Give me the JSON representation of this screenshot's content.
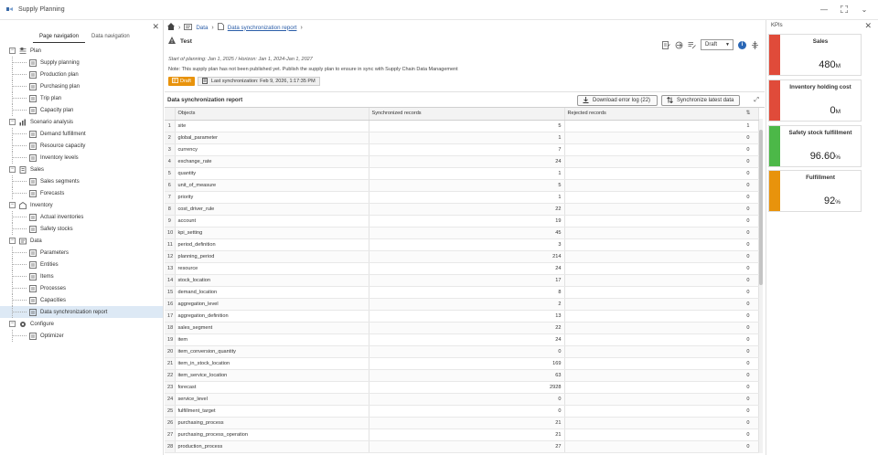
{
  "window": {
    "title": "Supply Planning"
  },
  "left_panel": {
    "tabs": [
      "Page navigation",
      "Data navigation"
    ],
    "tree": [
      {
        "label": "Plan",
        "icon": "plan-icon",
        "children": [
          {
            "label": "Supply planning",
            "icon": "supply-planning-icon"
          },
          {
            "label": "Production plan",
            "icon": "production-plan-icon"
          },
          {
            "label": "Purchasing plan",
            "icon": "purchasing-plan-icon"
          },
          {
            "label": "Trip plan",
            "icon": "trip-plan-icon"
          },
          {
            "label": "Capacity plan",
            "icon": "capacity-plan-icon"
          }
        ]
      },
      {
        "label": "Scenario analysis",
        "icon": "scenario-analysis-icon",
        "children": [
          {
            "label": "Demand fulfillment",
            "icon": "demand-fulfillment-icon"
          },
          {
            "label": "Resource capacity",
            "icon": "resource-capacity-icon"
          },
          {
            "label": "Inventory levels",
            "icon": "inventory-levels-icon"
          }
        ]
      },
      {
        "label": "Sales",
        "icon": "sales-icon",
        "children": [
          {
            "label": "Sales segments",
            "icon": "sales-segments-icon"
          },
          {
            "label": "Forecasts",
            "icon": "forecasts-icon"
          }
        ]
      },
      {
        "label": "Inventory",
        "icon": "inventory-icon",
        "children": [
          {
            "label": "Actual inventories",
            "icon": "actual-inventories-icon"
          },
          {
            "label": "Safety stocks",
            "icon": "safety-stocks-icon"
          }
        ]
      },
      {
        "label": "Data",
        "icon": "data-icon",
        "children": [
          {
            "label": "Parameters",
            "icon": "parameters-icon"
          },
          {
            "label": "Entities",
            "icon": "entities-icon"
          },
          {
            "label": "Items",
            "icon": "items-icon"
          },
          {
            "label": "Processes",
            "icon": "processes-icon"
          },
          {
            "label": "Capacities",
            "icon": "capacities-icon"
          },
          {
            "label": "Data synchronization report",
            "icon": "report-icon",
            "selected": true
          }
        ]
      },
      {
        "label": "Configure",
        "icon": "configure-icon",
        "children": [
          {
            "label": "Optimizer",
            "icon": "optimizer-icon"
          }
        ]
      }
    ]
  },
  "main": {
    "breadcrumb": {
      "root": "Data",
      "current": "Data synchronization report"
    },
    "plan_name": "Test",
    "status_select": "Draft",
    "meta": "Start of planning: Jan 1, 2025 / Horizon: Jan 1, 2024-Jan 1, 2027",
    "note": "Note: This supply plan has not been published yet. Publish the supply plan to ensure in sync with Supply Chain Data Management",
    "badge_draft": "Draft",
    "badge_sync": "Last synchronization: Feb 9, 2026, 1:17:35 PM",
    "report_title": "Data synchronization report",
    "download_label": "Download error log (22)",
    "sync_label": "Synchronize latest data",
    "columns": [
      "Objects",
      "Synchronized records",
      "Rejected records"
    ],
    "rows": [
      {
        "n": "1",
        "obj": "site",
        "sync": "5",
        "rej": "1"
      },
      {
        "n": "2",
        "obj": "global_parameter",
        "sync": "1",
        "rej": "0"
      },
      {
        "n": "3",
        "obj": "currency",
        "sync": "7",
        "rej": "0"
      },
      {
        "n": "4",
        "obj": "exchange_rate",
        "sync": "24",
        "rej": "0"
      },
      {
        "n": "5",
        "obj": "quantity",
        "sync": "1",
        "rej": "0"
      },
      {
        "n": "6",
        "obj": "unit_of_measure",
        "sync": "5",
        "rej": "0"
      },
      {
        "n": "7",
        "obj": "priority",
        "sync": "1",
        "rej": "0"
      },
      {
        "n": "8",
        "obj": "cost_driver_rule",
        "sync": "22",
        "rej": "0"
      },
      {
        "n": "9",
        "obj": "account",
        "sync": "19",
        "rej": "0"
      },
      {
        "n": "10",
        "obj": "kpi_setting",
        "sync": "45",
        "rej": "0"
      },
      {
        "n": "11",
        "obj": "period_definition",
        "sync": "3",
        "rej": "0"
      },
      {
        "n": "12",
        "obj": "planning_period",
        "sync": "214",
        "rej": "0"
      },
      {
        "n": "13",
        "obj": "resource",
        "sync": "24",
        "rej": "0"
      },
      {
        "n": "14",
        "obj": "stock_location",
        "sync": "17",
        "rej": "0"
      },
      {
        "n": "15",
        "obj": "demand_location",
        "sync": "8",
        "rej": "0"
      },
      {
        "n": "16",
        "obj": "aggregation_level",
        "sync": "2",
        "rej": "0"
      },
      {
        "n": "17",
        "obj": "aggregation_definition",
        "sync": "13",
        "rej": "0"
      },
      {
        "n": "18",
        "obj": "sales_segment",
        "sync": "22",
        "rej": "0"
      },
      {
        "n": "19",
        "obj": "item",
        "sync": "24",
        "rej": "0"
      },
      {
        "n": "20",
        "obj": "item_conversion_quantity",
        "sync": "0",
        "rej": "0"
      },
      {
        "n": "21",
        "obj": "item_in_stock_location",
        "sync": "169",
        "rej": "0"
      },
      {
        "n": "22",
        "obj": "item_service_location",
        "sync": "63",
        "rej": "0"
      },
      {
        "n": "23",
        "obj": "forecast",
        "sync": "2928",
        "rej": "0"
      },
      {
        "n": "24",
        "obj": "service_level",
        "sync": "0",
        "rej": "0"
      },
      {
        "n": "25",
        "obj": "fulfillment_target",
        "sync": "0",
        "rej": "0"
      },
      {
        "n": "26",
        "obj": "purchasing_process",
        "sync": "21",
        "rej": "0"
      },
      {
        "n": "27",
        "obj": "purchasing_process_operation",
        "sync": "21",
        "rej": "0"
      },
      {
        "n": "28",
        "obj": "production_process",
        "sync": "27",
        "rej": "0"
      }
    ]
  },
  "kpis": {
    "title": "KPIs",
    "cards": [
      {
        "name": "Sales",
        "value": "480",
        "unit": "M",
        "color": "#e04b3a"
      },
      {
        "name": "Inventory holding cost",
        "value": "0",
        "unit": "M",
        "color": "#e04b3a"
      },
      {
        "name": "Safety stock fulfillment",
        "value": "96.60",
        "unit": "%",
        "color": "#4cb848"
      },
      {
        "name": "Fulfillment",
        "value": "92",
        "unit": "%",
        "color": "#e8930c"
      }
    ]
  }
}
